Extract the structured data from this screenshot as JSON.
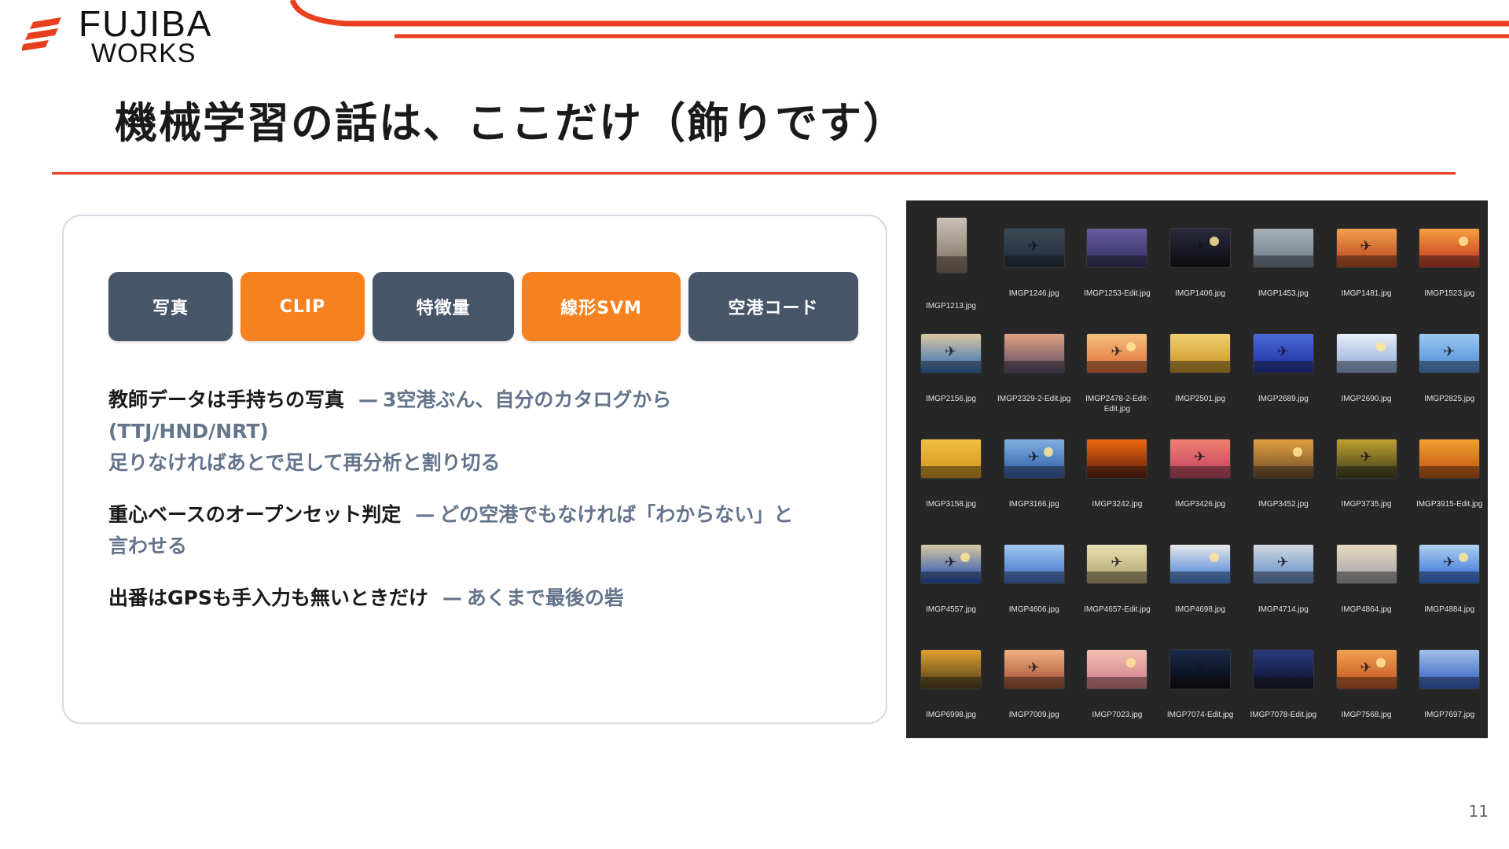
{
  "brand": {
    "line1": "FUJIBA",
    "line2": "WORKS",
    "accent": "#e8401f"
  },
  "slide": {
    "title": "機械学習の話は、ここだけ（飾りです）",
    "page_number": "11"
  },
  "pipeline": [
    {
      "label": "写真",
      "color": "#475569"
    },
    {
      "label": "CLIP",
      "color": "#f5821f"
    },
    {
      "label": "特徴量",
      "color": "#475569"
    },
    {
      "label": "線形SVM",
      "color": "#f5821f"
    },
    {
      "label": "空港コード",
      "color": "#475569"
    }
  ],
  "points": [
    {
      "head": "教師データは手持ちの写真",
      "sep": "—",
      "sub": "3空港ぶん、自分のカタログから",
      "sub2": "(TTJ/HND/NRT)",
      "sub3": "足りなければあとで足して再分析と割り切る"
    },
    {
      "head": "重心ベースのオープンセット判定",
      "sep": "—",
      "sub": "どの空港でもなければ「わからない」と",
      "sub2": "言わせる"
    },
    {
      "head": "出番はGPSも手入力も無いときだけ",
      "sep": "—",
      "sub": "あくまで最後の砦"
    }
  ],
  "photos": [
    {
      "name": "IMGP1213.jpg",
      "colors": [
        "#7a6a5a",
        "#c9c2b8"
      ],
      "tall": true
    },
    {
      "name": "IMGP1246.jpg",
      "colors": [
        "#1d2a38",
        "#3c4a56"
      ]
    },
    {
      "name": "IMGP1253-Edit.jpg",
      "colors": [
        "#2a2f5a",
        "#6a5aa0"
      ]
    },
    {
      "name": "IMGP1406.jpg",
      "colors": [
        "#0c0c14",
        "#2a2a3a"
      ]
    },
    {
      "name": "IMGP1453.jpg",
      "colors": [
        "#6a7a8a",
        "#a6b0b8"
      ]
    },
    {
      "name": "IMGP1481.jpg",
      "colors": [
        "#b8401a",
        "#f0a050"
      ]
    },
    {
      "name": "IMGP1523.jpg",
      "colors": [
        "#c03020",
        "#f5a040"
      ]
    },
    {
      "name": "IMGP2156.jpg",
      "colors": [
        "#2a6ab8",
        "#d8c8a0"
      ]
    },
    {
      "name": "IMGP2329-2-Edit.jpg",
      "colors": [
        "#5a4a6a",
        "#e0a080"
      ]
    },
    {
      "name": "IMGP2478-2-Edit-Edit.jpg",
      "colors": [
        "#e06a30",
        "#f5c080"
      ]
    },
    {
      "name": "IMGP2501.jpg",
      "colors": [
        "#c89020",
        "#f0d070"
      ]
    },
    {
      "name": "IMGP2689.jpg",
      "colors": [
        "#1a2a9a",
        "#4a6ad8"
      ]
    },
    {
      "name": "IMGP2690.jpg",
      "colors": [
        "#8aa8d8",
        "#e8eef8"
      ]
    },
    {
      "name": "IMGP2825.jpg",
      "colors": [
        "#4a8ad8",
        "#9ac8f0"
      ]
    },
    {
      "name": "IMGP3158.jpg",
      "colors": [
        "#d0901a",
        "#f0c040"
      ]
    },
    {
      "name": "IMGP3166.jpg",
      "colors": [
        "#2a5aa8",
        "#80b0e0"
      ]
    },
    {
      "name": "IMGP3242.jpg",
      "colors": [
        "#5a1a0a",
        "#f06a10"
      ]
    },
    {
      "name": "IMGP3426.jpg",
      "colors": [
        "#c04060",
        "#f08070"
      ]
    },
    {
      "name": "IMGP3452.jpg",
      "colors": [
        "#6a4a2a",
        "#e0a040"
      ]
    },
    {
      "name": "IMGP3735.jpg",
      "colors": [
        "#3a3a1a",
        "#c0a030"
      ]
    },
    {
      "name": "IMGP3915-Edit.jpg",
      "colors": [
        "#c05010",
        "#f0a030"
      ]
    },
    {
      "name": "IMGP4557.jpg",
      "colors": [
        "#1a4ab8",
        "#d8c8a0"
      ]
    },
    {
      "name": "IMGP4606.jpg",
      "colors": [
        "#3a6ac8",
        "#a0c8f0"
      ]
    },
    {
      "name": "IMGP4657-Edit.jpg",
      "colors": [
        "#b0a070",
        "#e8e0b0"
      ]
    },
    {
      "name": "IMGP4698.jpg",
      "colors": [
        "#3a7ad8",
        "#e8e8e8"
      ]
    },
    {
      "name": "IMGP4714.jpg",
      "colors": [
        "#5a8ac8",
        "#d0d8e0"
      ]
    },
    {
      "name": "IMGP4864.jpg",
      "colors": [
        "#a0a0a8",
        "#e8d8c0"
      ]
    },
    {
      "name": "IMGP4884.jpg",
      "colors": [
        "#2a6ad8",
        "#b0d0f0"
      ]
    },
    {
      "name": "IMGP6998.jpg",
      "colors": [
        "#4a3a1a",
        "#e0a030"
      ]
    },
    {
      "name": "IMGP7009.jpg",
      "colors": [
        "#a04a30",
        "#f0b080"
      ]
    },
    {
      "name": "IMGP7023.jpg",
      "colors": [
        "#d07a8a",
        "#f0c0b0"
      ]
    },
    {
      "name": "IMGP7074-Edit.jpg",
      "colors": [
        "#05070f",
        "#1a2a4a"
      ]
    },
    {
      "name": "IMGP7078-Edit.jpg",
      "colors": [
        "#0a1028",
        "#2a3a80"
      ]
    },
    {
      "name": "IMGP7568.jpg",
      "colors": [
        "#c05020",
        "#f0a050"
      ]
    },
    {
      "name": "IMGP7697.jpg",
      "colors": [
        "#2a5ac0",
        "#a0c0e8"
      ]
    }
  ]
}
